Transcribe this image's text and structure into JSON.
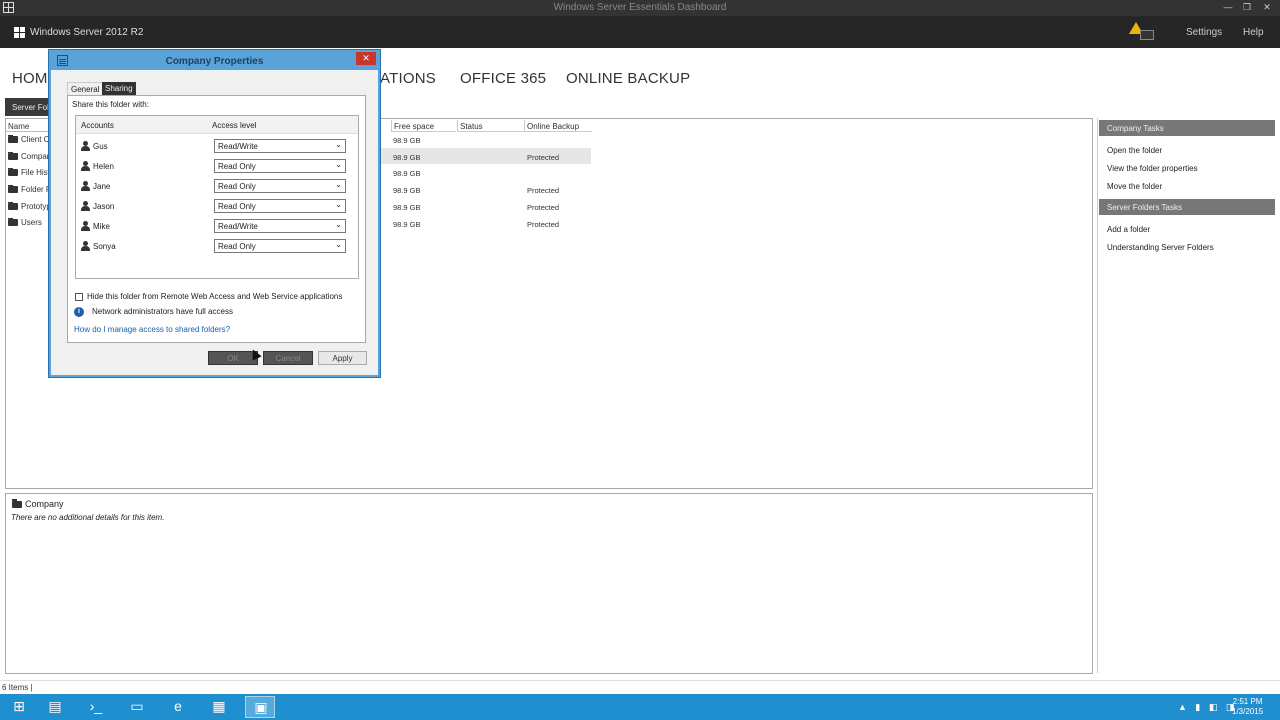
{
  "window": {
    "title": "Windows Server Essentials Dashboard",
    "min_glyph": "—",
    "max_glyph": "❐",
    "close_glyph": "✕"
  },
  "header": {
    "product": "Windows Server 2012 R2",
    "settings": "Settings",
    "help": "Help",
    "accent": "#262626"
  },
  "nav": {
    "items": [
      "HOME",
      "ATIONS",
      "OFFICE 365",
      "ONLINE BACKUP"
    ]
  },
  "subtab": {
    "label": "Server Folders"
  },
  "folders": {
    "column_name": "Name",
    "items": [
      "Client Computer Backups",
      "Company",
      "File History Backups",
      "Folder Redirection",
      "Prototypes",
      "Users"
    ]
  },
  "grid": {
    "headers": [
      "Free space",
      "Status",
      "Online Backup"
    ],
    "rows": [
      {
        "free": "98.9 GB",
        "status": "",
        "backup": ""
      },
      {
        "free": "98.9 GB",
        "status": "",
        "backup": "Protected"
      },
      {
        "free": "98.9 GB",
        "status": "",
        "backup": ""
      },
      {
        "free": "98.9 GB",
        "status": "",
        "backup": "Protected"
      },
      {
        "free": "98.9 GB",
        "status": "",
        "backup": "Protected"
      },
      {
        "free": "98.9 GB",
        "status": "",
        "backup": "Protected"
      }
    ]
  },
  "tasks": {
    "company_head": "Company Tasks",
    "company_items": [
      "Open the folder",
      "View the folder properties",
      "Move the folder"
    ],
    "server_head": "Server Folders Tasks",
    "server_items": [
      "Add a folder",
      "Understanding Server Folders"
    ]
  },
  "details": {
    "name": "Company",
    "text": "There are no additional details for this item."
  },
  "status": {
    "count": "6 Items"
  },
  "taskbar": {
    "time": "2:51 PM",
    "date": "1/3/2015",
    "accent": "#1f8fcf"
  },
  "dialog": {
    "title": "Company Properties",
    "close_glyph": "✕",
    "tabs": [
      "General",
      "Sharing"
    ],
    "share_label": "Share this folder with:",
    "col_accounts": "Accounts",
    "col_access": "Access level",
    "accounts": [
      {
        "name": "Gus",
        "access": "Read/Write"
      },
      {
        "name": "Helen",
        "access": "Read Only"
      },
      {
        "name": "Jane",
        "access": "Read Only"
      },
      {
        "name": "Jason",
        "access": "Read Only"
      },
      {
        "name": "Mike",
        "access": "Read/Write"
      },
      {
        "name": "Sonya",
        "access": "Read Only"
      }
    ],
    "hide_label": "Hide this folder from Remote Web Access and Web Service applications",
    "info_text": "Network administrators have full access",
    "help_link": "How do I manage access to shared folders?",
    "ok": "OK",
    "cancel": "Cancel",
    "apply": "Apply",
    "accent": "#5aa3d8"
  }
}
